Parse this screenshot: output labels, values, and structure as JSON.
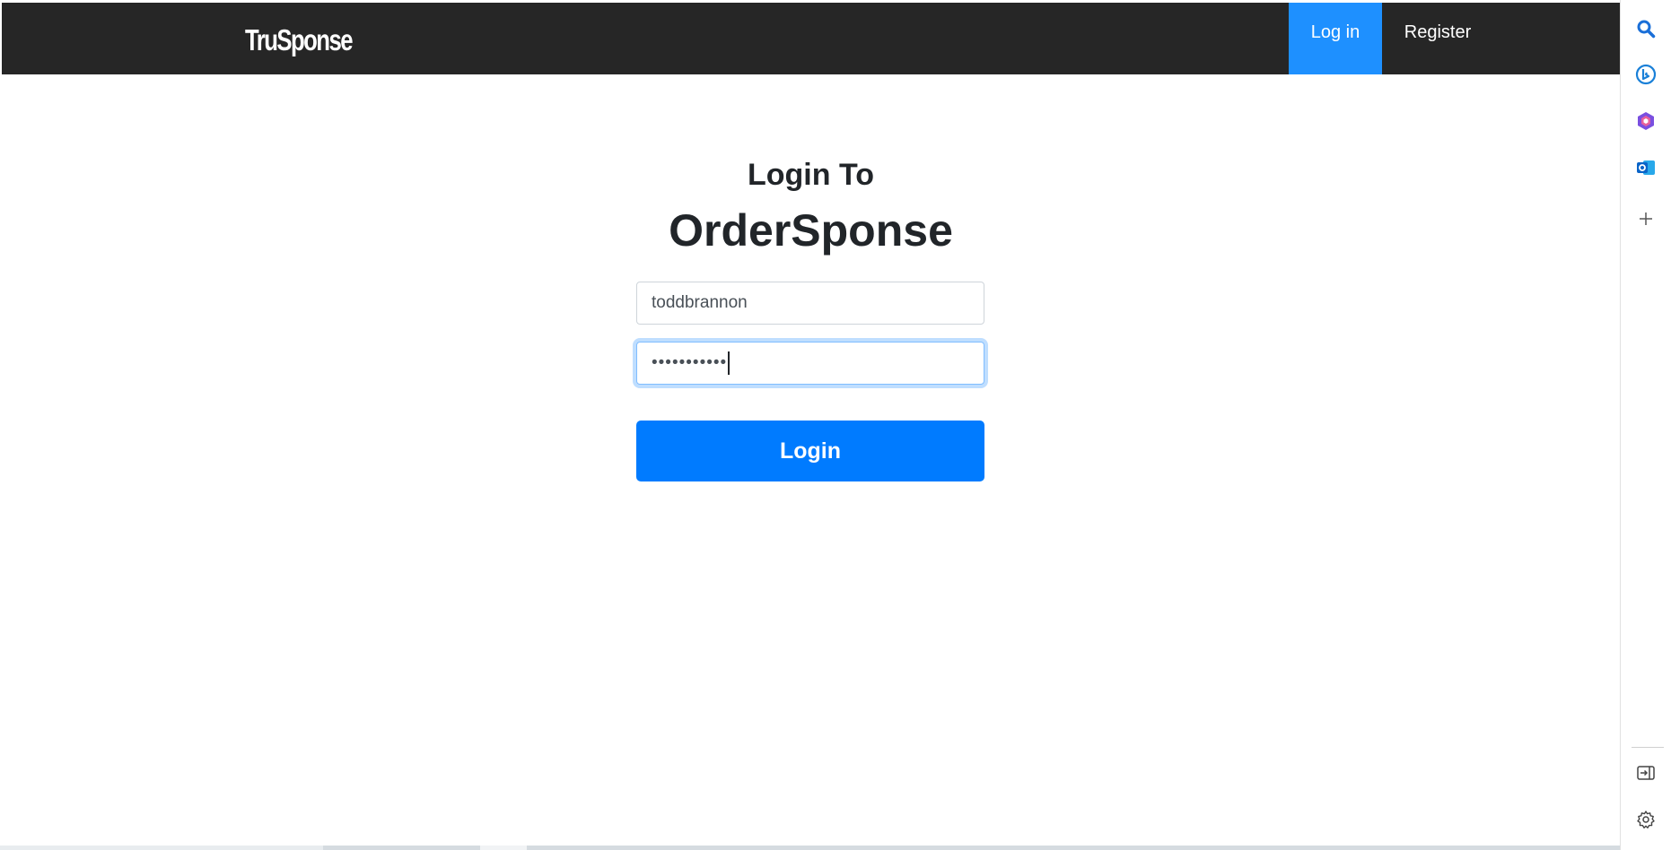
{
  "navbar": {
    "brand": "TruSponse",
    "items": [
      {
        "label": "Log in",
        "active": true
      },
      {
        "label": "Register",
        "active": false
      }
    ],
    "background": "#262626",
    "active_color": "#1e90ff"
  },
  "login": {
    "heading": "Login To",
    "app_name": "OrderSponse",
    "username_value": "toddbrannon",
    "password_masked": "•••••••••••",
    "button_label": "Login",
    "button_color": "#007bff"
  },
  "sidebar": {
    "icons": [
      "search-icon",
      "bing-chat-icon",
      "office-icon",
      "outlook-icon",
      "add-icon",
      "exit-side-panel-icon",
      "settings-icon"
    ]
  }
}
